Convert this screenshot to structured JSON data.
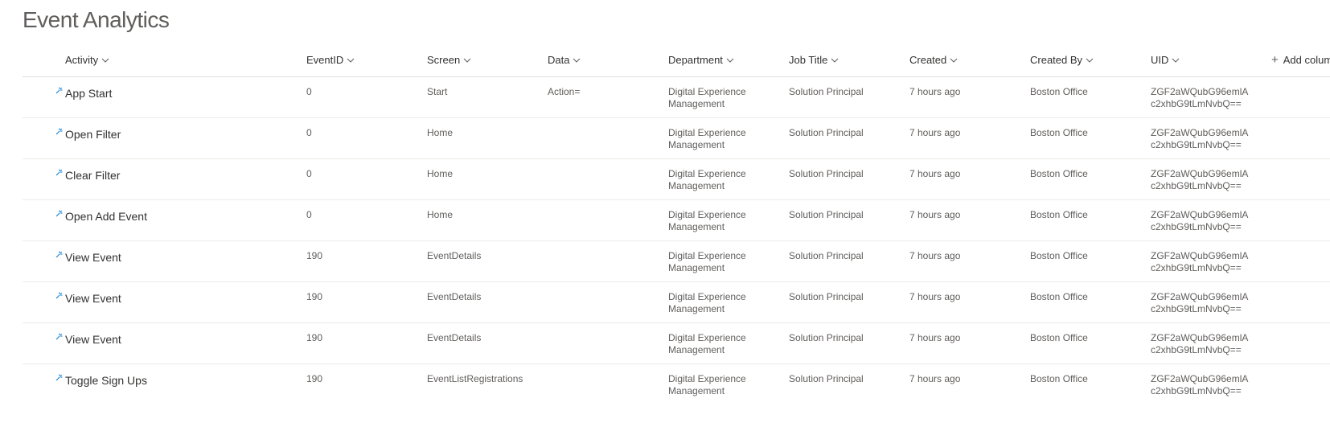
{
  "page": {
    "title": "Event Analytics"
  },
  "columns": [
    {
      "key": "activity",
      "label": "Activity"
    },
    {
      "key": "eventid",
      "label": "EventID"
    },
    {
      "key": "screen",
      "label": "Screen"
    },
    {
      "key": "data",
      "label": "Data"
    },
    {
      "key": "department",
      "label": "Department"
    },
    {
      "key": "jobtitle",
      "label": "Job Title"
    },
    {
      "key": "created",
      "label": "Created"
    },
    {
      "key": "createdby",
      "label": "Created By"
    },
    {
      "key": "uid",
      "label": "UID"
    }
  ],
  "add_column_label": "Add colum",
  "icons": {
    "new_item": "new-item-sparkle-icon",
    "sort": "chevron-down-icon",
    "add": "plus-icon"
  },
  "colors": {
    "accent": "#0078d4"
  },
  "rows": [
    {
      "activity": "App Start",
      "eventid": "0",
      "screen": "Start",
      "data": "Action=",
      "department": "Digital Experience Management",
      "jobtitle": "Solution Principal",
      "created": "7 hours ago",
      "createdby": "Boston Office",
      "uid": "ZGF2aWQubG96emlA c2xhbG9tLmNvbQ=="
    },
    {
      "activity": "Open Filter",
      "eventid": "0",
      "screen": "Home",
      "data": "",
      "department": "Digital Experience Management",
      "jobtitle": "Solution Principal",
      "created": "7 hours ago",
      "createdby": "Boston Office",
      "uid": "ZGF2aWQubG96emlA c2xhbG9tLmNvbQ=="
    },
    {
      "activity": "Clear Filter",
      "eventid": "0",
      "screen": "Home",
      "data": "",
      "department": "Digital Experience Management",
      "jobtitle": "Solution Principal",
      "created": "7 hours ago",
      "createdby": "Boston Office",
      "uid": "ZGF2aWQubG96emlA c2xhbG9tLmNvbQ=="
    },
    {
      "activity": "Open Add Event",
      "eventid": "0",
      "screen": "Home",
      "data": "",
      "department": "Digital Experience Management",
      "jobtitle": "Solution Principal",
      "created": "7 hours ago",
      "createdby": "Boston Office",
      "uid": "ZGF2aWQubG96emlA c2xhbG9tLmNvbQ=="
    },
    {
      "activity": "View Event",
      "eventid": "190",
      "screen": "EventDetails",
      "data": "",
      "department": "Digital Experience Management",
      "jobtitle": "Solution Principal",
      "created": "7 hours ago",
      "createdby": "Boston Office",
      "uid": "ZGF2aWQubG96emlA c2xhbG9tLmNvbQ=="
    },
    {
      "activity": "View Event",
      "eventid": "190",
      "screen": "EventDetails",
      "data": "",
      "department": "Digital Experience Management",
      "jobtitle": "Solution Principal",
      "created": "7 hours ago",
      "createdby": "Boston Office",
      "uid": "ZGF2aWQubG96emlA c2xhbG9tLmNvbQ=="
    },
    {
      "activity": "View Event",
      "eventid": "190",
      "screen": "EventDetails",
      "data": "",
      "department": "Digital Experience Management",
      "jobtitle": "Solution Principal",
      "created": "7 hours ago",
      "createdby": "Boston Office",
      "uid": "ZGF2aWQubG96emlA c2xhbG9tLmNvbQ=="
    },
    {
      "activity": "Toggle Sign Ups",
      "eventid": "190",
      "screen": "EventListRegistrations",
      "data": "",
      "department": "Digital Experience Management",
      "jobtitle": "Solution Principal",
      "created": "7 hours ago",
      "createdby": "Boston Office",
      "uid": "ZGF2aWQubG96emlA c2xhbG9tLmNvbQ=="
    }
  ]
}
